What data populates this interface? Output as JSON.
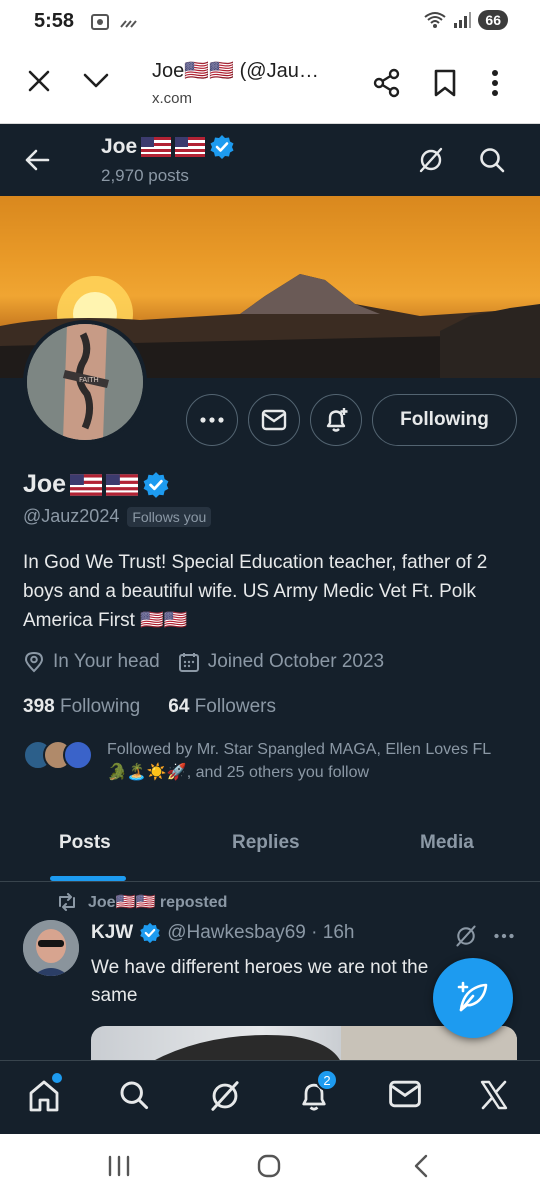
{
  "status_bar": {
    "time": "5:58",
    "battery": "66"
  },
  "browser": {
    "title": "Joe🇺🇸🇺🇸 (@Jau…",
    "domain": "x.com"
  },
  "header": {
    "name": "Joe",
    "posts_count": "2,970 posts"
  },
  "profile": {
    "name": "Joe",
    "handle": "@Jauz2024",
    "follows_you": "Follows you",
    "bio": "In God We Trust! Special Education teacher, father of 2 boys and a beautiful wife. US Army Medic Vet Ft. Polk America First 🇺🇸🇺🇸",
    "location": "In Your head",
    "joined": "Joined October 2023",
    "following_count": "398",
    "following_label": "Following",
    "followers_count": "64",
    "followers_label": "Followers",
    "followed_by": "Followed by Mr. Star Spangled MAGA, Ellen Loves FL🐊🏝️☀️🚀, and 25 others you follow",
    "following_button": "Following"
  },
  "tabs": [
    {
      "label": "Posts",
      "active": true
    },
    {
      "label": "Replies",
      "active": false
    },
    {
      "label": "Media",
      "active": false
    }
  ],
  "post": {
    "repost_label": "Joe🇺🇸🇺🇸 reposted",
    "author": "KJW",
    "handle_time": "@Hawkesbay69 · 16h",
    "text": "We have different heroes we are not the same"
  },
  "bottom_nav": {
    "notification_count": "2"
  },
  "colors": {
    "accent": "#1d9bf0",
    "background": "#15202b",
    "border": "#38444d"
  },
  "icons": [
    "close-icon",
    "chevron-down-icon",
    "share-icon",
    "bookmark-icon",
    "more-vert-icon",
    "back-arrow-icon",
    "grok-icon",
    "search-icon",
    "more-horizontal-icon",
    "mail-icon",
    "bell-plus-icon",
    "verified-icon",
    "location-icon",
    "calendar-icon",
    "repost-icon",
    "compose-icon",
    "home-icon",
    "bell-icon",
    "x-logo-icon"
  ]
}
